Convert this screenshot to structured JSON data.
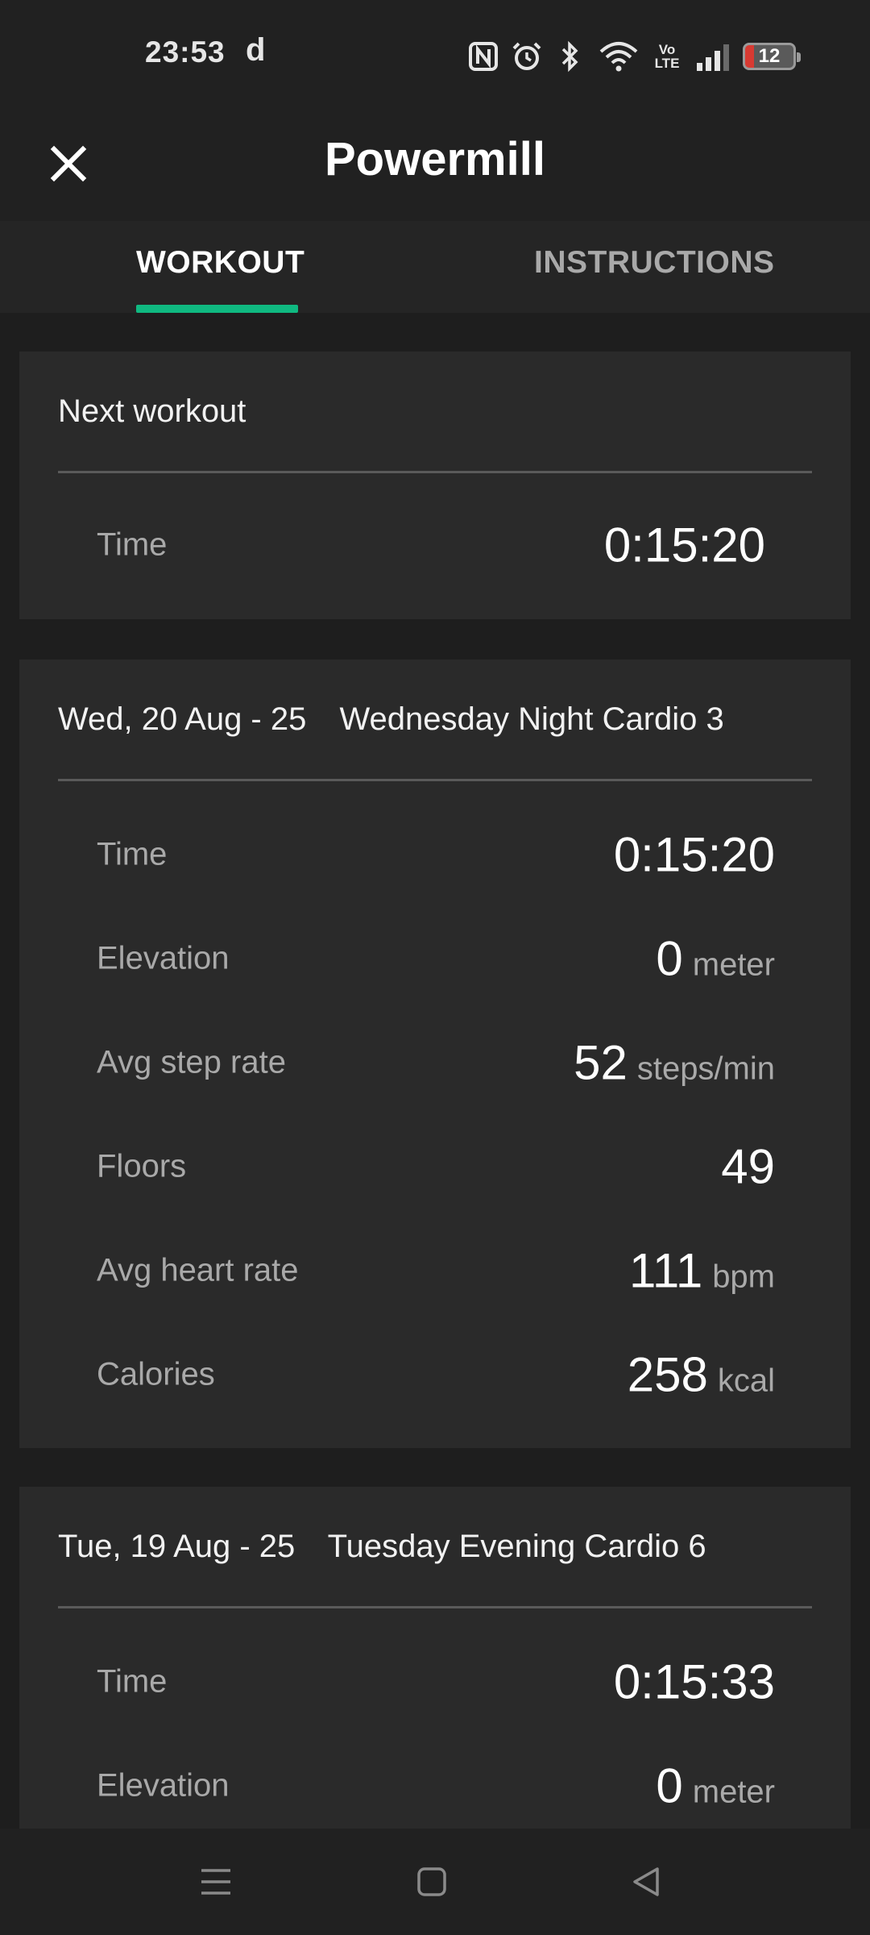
{
  "status_bar": {
    "time": "23:53",
    "app_glyph": "d",
    "icons": [
      "nfc-icon",
      "alarm-icon",
      "bluetooth-icon",
      "wifi-icon",
      "volte-icon",
      "signal-icon",
      "battery-icon"
    ],
    "volte_top": "Vo",
    "volte_bottom": "LTE",
    "battery_level": "12"
  },
  "header": {
    "title": "Powermill",
    "close_icon": "close-icon"
  },
  "tabs": [
    {
      "label": "WORKOUT",
      "active": true
    },
    {
      "label": "INSTRUCTIONS",
      "active": false
    }
  ],
  "next_workout": {
    "title": "Next workout",
    "time_label": "Time",
    "time_value": "0:15:20"
  },
  "workouts": [
    {
      "date": "Wed, 20 Aug - 25",
      "name": "Wednesday Night Cardio 3",
      "stats": [
        {
          "label": "Time",
          "value": "0:15:20",
          "unit": ""
        },
        {
          "label": "Elevation",
          "value": "0",
          "unit": "meter"
        },
        {
          "label": "Avg step rate",
          "value": "52",
          "unit": "steps/min"
        },
        {
          "label": "Floors",
          "value": "49",
          "unit": ""
        },
        {
          "label": "Avg heart rate",
          "value": "111",
          "unit": "bpm"
        },
        {
          "label": "Calories",
          "value": "258",
          "unit": "kcal"
        }
      ]
    },
    {
      "date": "Tue, 19 Aug - 25",
      "name": "Tuesday Evening Cardio 6",
      "stats": [
        {
          "label": "Time",
          "value": "0:15:33",
          "unit": ""
        },
        {
          "label": "Elevation",
          "value": "0",
          "unit": "meter"
        }
      ]
    }
  ],
  "nav_bar": {
    "icons": [
      "menu-icon",
      "home-icon",
      "back-icon"
    ]
  },
  "colors": {
    "accent": "#10b981",
    "background": "#1e1e1e",
    "card": "#2a2a2a",
    "muted_text": "#a9a9a9"
  }
}
